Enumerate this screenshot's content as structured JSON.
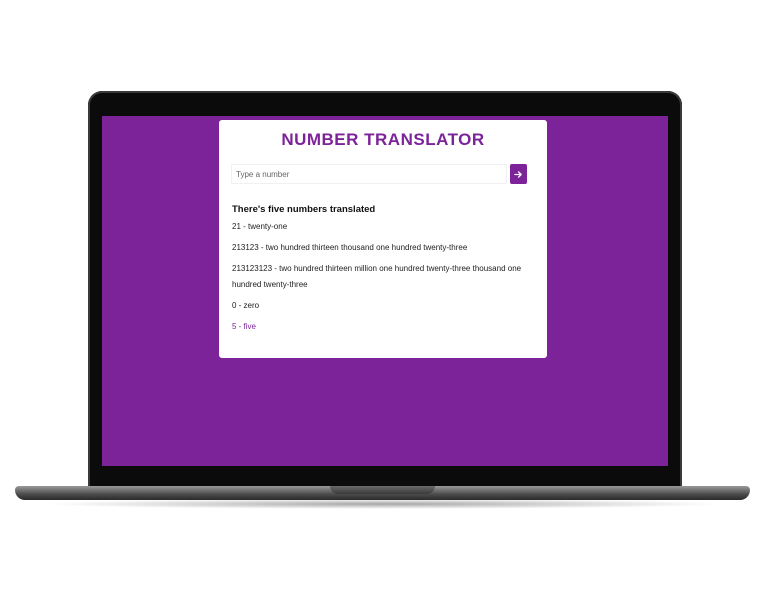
{
  "app": {
    "title": "NUMBER TRANSLATOR",
    "accent_color": "#7d2399",
    "background_color": "#7d2399"
  },
  "input": {
    "placeholder": "Type a number",
    "value": "",
    "submit_icon": "arrow-right-icon"
  },
  "results": {
    "heading": "There's five numbers translated",
    "items": [
      {
        "text": "21 - twenty-one"
      },
      {
        "text": "213123 - two hundred thirteen thousand one hundred twenty-three"
      },
      {
        "text": "213123123 - two hundred thirteen million one hundred twenty-three thousand one hundred twenty-three"
      },
      {
        "text": "0 - zero"
      },
      {
        "text": "5 - five"
      }
    ]
  }
}
